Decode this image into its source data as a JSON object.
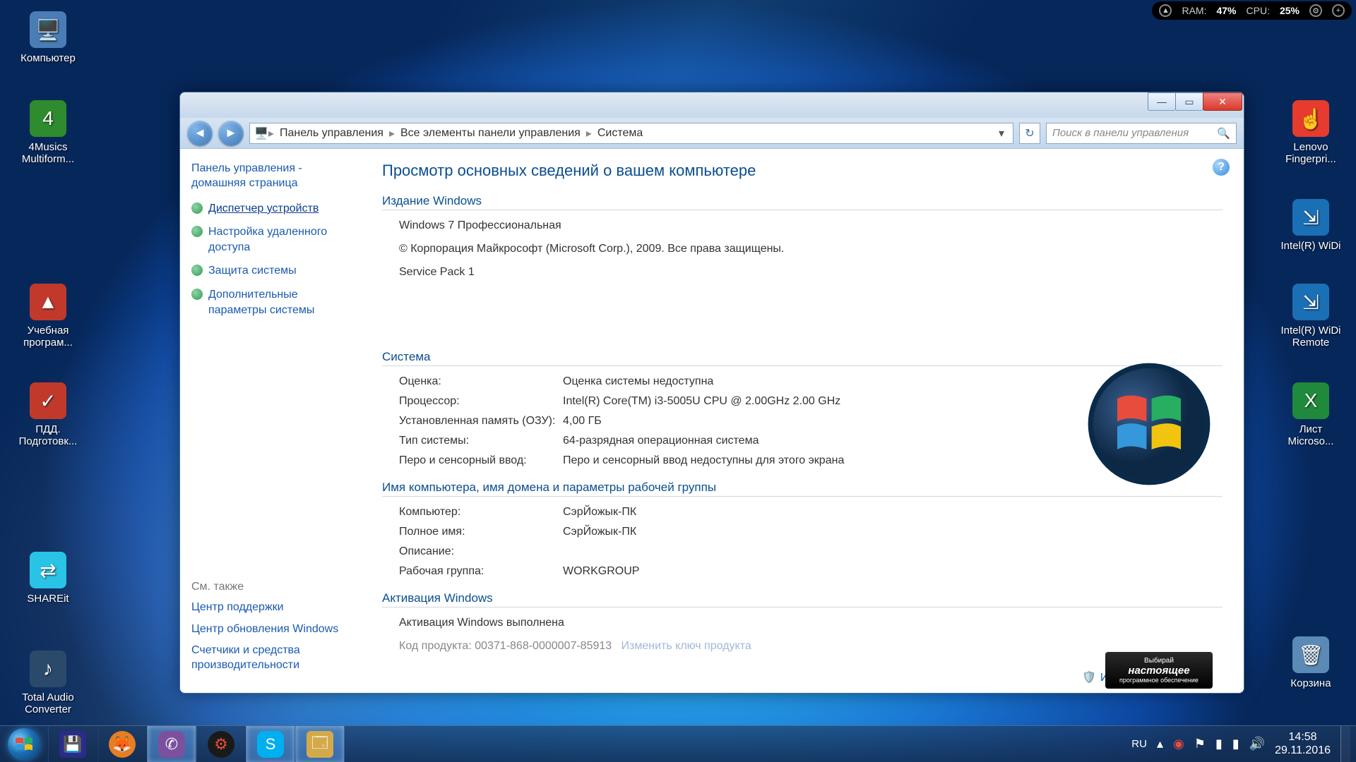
{
  "sysmon": {
    "ram_label": "RAM:",
    "ram_value": "47%",
    "cpu_label": "CPU:",
    "cpu_value": "25%"
  },
  "desktop_icons_left": [
    {
      "name": "computer",
      "label": "Компьютер",
      "color": "#4a7db5"
    },
    {
      "name": "4musics",
      "label": "4Musics Multiform...",
      "color": "#2e8b2e"
    },
    {
      "name": "uchebnaya",
      "label": "Учебная програм...",
      "color": "#c0392b"
    },
    {
      "name": "pdd",
      "label": "ПДД. Подготовк...",
      "color": "#c0392b"
    },
    {
      "name": "shareit",
      "label": "SHAREit",
      "color": "#29c3e6"
    },
    {
      "name": "total-audio",
      "label": "Total Audio Converter",
      "color": "#2b4a6b"
    }
  ],
  "desktop_icons_right": [
    {
      "name": "lenovo-fp",
      "label": "Lenovo Fingerpri...",
      "color": "#e63b2e"
    },
    {
      "name": "intel-widi",
      "label": "Intel(R) WiDi",
      "color": "#1b6fb5"
    },
    {
      "name": "intel-widi-remote",
      "label": "Intel(R) WiDi Remote",
      "color": "#1b6fb5"
    },
    {
      "name": "excel-sheet",
      "label": "Лист Microso...",
      "color": "#1f8a3b"
    },
    {
      "name": "recycle-bin",
      "label": "Корзина",
      "color": "#5a8ab5"
    }
  ],
  "window": {
    "breadcrumbs": [
      "Панель управления",
      "Все элементы панели управления",
      "Система"
    ],
    "search_placeholder": "Поиск в панели управления",
    "sidebar": {
      "home": "Панель управления - домашняя страница",
      "links": [
        "Диспетчер устройств",
        "Настройка удаленного доступа",
        "Защита системы",
        "Дополнительные параметры системы"
      ],
      "see_also": "См. также",
      "footer": [
        "Центр поддержки",
        "Центр обновления Windows",
        "Счетчики и средства производительности"
      ]
    },
    "heading": "Просмотр основных сведений о вашем компьютере",
    "edition": {
      "title": "Издание Windows",
      "name": "Windows 7 Профессиональная",
      "copyright": "© Корпорация Майкрософт (Microsoft Corp.), 2009. Все права защищены.",
      "sp": "Service Pack 1"
    },
    "system": {
      "title": "Система",
      "rating_k": "Оценка:",
      "rating_v": "Оценка системы недоступна",
      "cpu_k": "Процессор:",
      "cpu_v": "Intel(R) Core(TM) i3-5005U CPU @ 2.00GHz   2.00 GHz",
      "ram_k": "Установленная память (ОЗУ):",
      "ram_v": "4,00 ГБ",
      "type_k": "Тип системы:",
      "type_v": "64-разрядная операционная система",
      "pen_k": "Перо и сенсорный ввод:",
      "pen_v": "Перо и сенсорный ввод недоступны для этого экрана"
    },
    "computer": {
      "title": "Имя компьютера, имя домена и параметры рабочей группы",
      "name_k": "Компьютер:",
      "name_v": "СэрЙожык-ПК",
      "full_k": "Полное имя:",
      "full_v": "СэрЙожык-ПК",
      "desc_k": "Описание:",
      "desc_v": "",
      "wg_k": "Рабочая группа:",
      "wg_v": "WORKGROUP",
      "change": "Изменить параметры"
    },
    "activation": {
      "title": "Активация Windows",
      "status": "Активация Windows выполнена",
      "pid_k": "Код продукта: 00371-868-0000007-85913",
      "pid_link": "Изменить ключ продукта"
    },
    "genuine": {
      "l1": "Выбирай",
      "l2": "настоящее",
      "l3": "программное обеспечение"
    }
  },
  "taskbar": {
    "lang": "RU",
    "time": "14:58",
    "date": "29.11.2016"
  }
}
